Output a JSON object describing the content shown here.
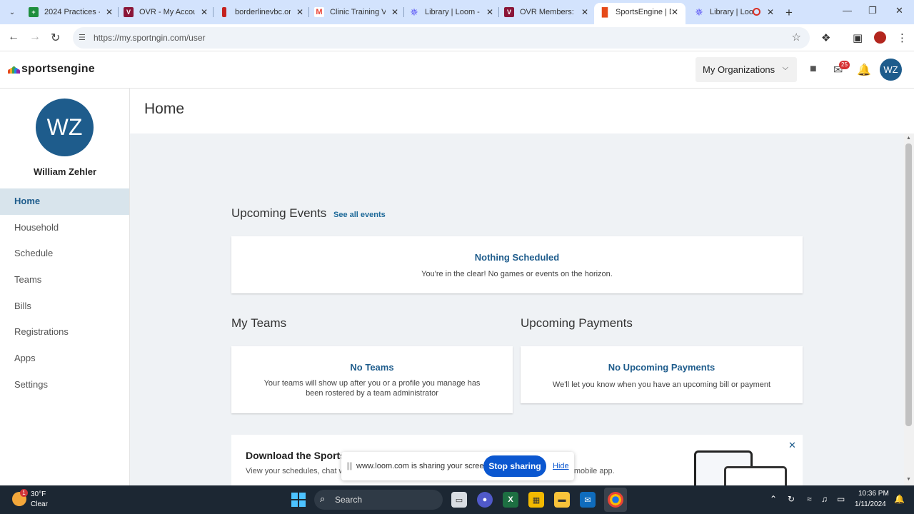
{
  "browser": {
    "tabs": [
      {
        "title": "2024 Practices -",
        "icon": "sheets-icon",
        "color": "#1e8e3e"
      },
      {
        "title": "OVR - My Accou",
        "icon": "ovr-icon",
        "color": "#8a1538"
      },
      {
        "title": "borderlinevbc.or",
        "icon": "bookmark-icon",
        "color": "#c5221f"
      },
      {
        "title": "Clinic Training Vi",
        "icon": "gmail-icon",
        "color": "#ea4335"
      },
      {
        "title": "Library | Loom -",
        "icon": "loom-icon",
        "color": "#625df5"
      },
      {
        "title": "OVR Members: 2",
        "icon": "ovr-icon",
        "color": "#8a1538"
      },
      {
        "title": "SportsEngine | D",
        "icon": "sportsengine-icon",
        "color": "#e64a19"
      },
      {
        "title": "Library | Loo",
        "icon": "loom-icon",
        "color": "#625df5"
      }
    ],
    "url": "https://my.sportngin.com/user"
  },
  "header": {
    "logo_text": "sportsengine",
    "org_button": "My Organizations",
    "mail_badge": "25",
    "avatar_initials": "WZ"
  },
  "sidebar": {
    "avatar_initials": "WZ",
    "user_name": "William Zehler",
    "items": [
      "Home",
      "Household",
      "Schedule",
      "Teams",
      "Bills",
      "Registrations",
      "Apps",
      "Settings"
    ]
  },
  "main": {
    "page_title": "Home",
    "upcoming_events": {
      "title": "Upcoming Events",
      "see_all": "See all events",
      "card_title": "Nothing Scheduled",
      "card_text": "You're in the clear! No games or events on the horizon."
    },
    "my_teams": {
      "title": "My Teams",
      "card_title": "No Teams",
      "card_text": "Your teams will show up after you or a profile you manage has been rostered by a team administrator"
    },
    "upcoming_payments": {
      "title": "Upcoming Payments",
      "card_title": "No Upcoming Payments",
      "card_text": "We'll let you know when you have an upcoming bill or payment"
    },
    "promo": {
      "title": "Download the Sports",
      "text_left": "View your schedules, chat w",
      "text_right": "gine mobile app."
    }
  },
  "share_bar": {
    "text": "www.loom.com is sharing your screen.",
    "stop": "Stop sharing",
    "hide": "Hide"
  },
  "taskbar": {
    "weather_badge": "1",
    "temperature": "30°F",
    "condition": "Clear",
    "search_placeholder": "Search",
    "time": "10:36 PM",
    "date": "1/11/2024"
  },
  "colors": {
    "brand": "#1e5c8c",
    "active_nav_bg": "#d8e4ec",
    "content_bg": "#eff2f5"
  }
}
